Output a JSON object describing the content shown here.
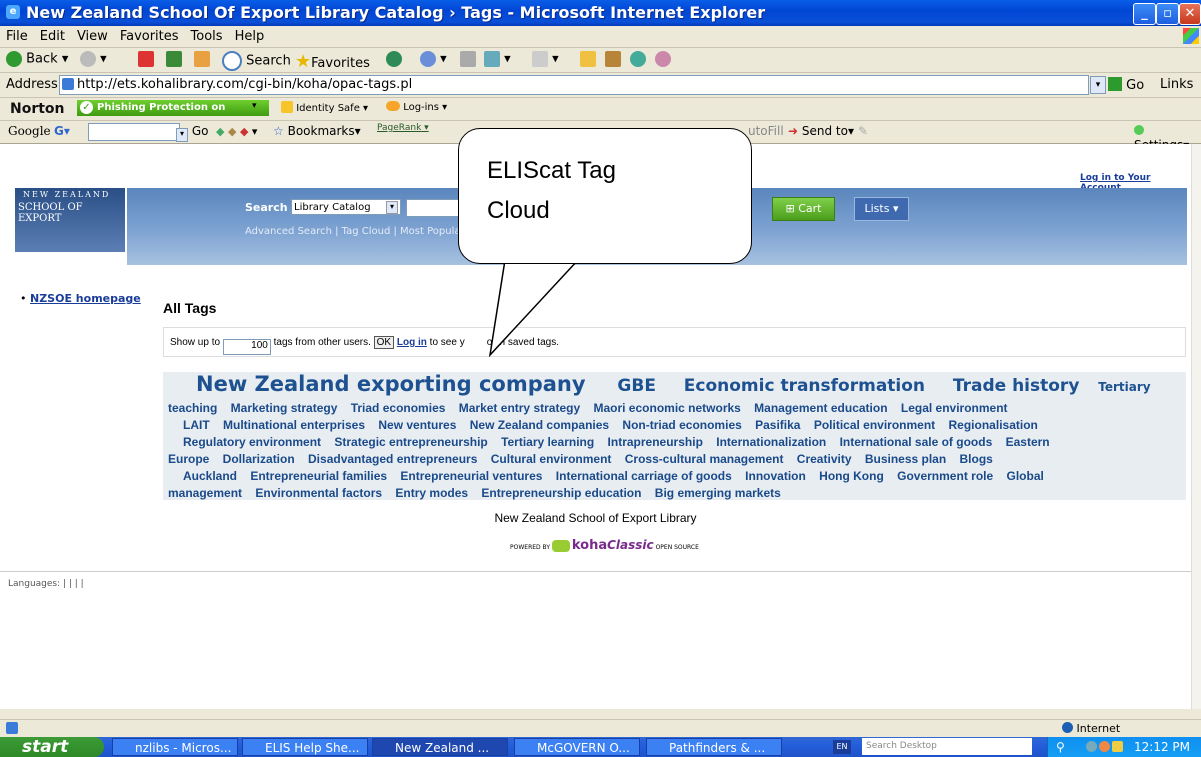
{
  "window": {
    "title": "New Zealand School Of Export Library Catalog › Tags - Microsoft Internet Explorer",
    "minimize": "_",
    "maximize": "▫",
    "close": "✕"
  },
  "menu": [
    "File",
    "Edit",
    "View",
    "Favorites",
    "Tools",
    "Help"
  ],
  "toolbar": {
    "back": "Back",
    "search": "Search",
    "favorites": "Favorites"
  },
  "address": {
    "label": "Address",
    "url": "http://ets.kohalibrary.com/cgi-bin/koha/opac-tags.pl",
    "go": "Go",
    "links": "Links"
  },
  "norton": {
    "brand": "Norton",
    "phishing": "Phishing Protection on",
    "identity": "Identity Safe ▾",
    "logins": "Log-ins ▾"
  },
  "google": {
    "brand": "Google",
    "go": "Go",
    "bookmarks": "Bookmarks▾",
    "pagerank": "PageRank",
    "autofill": "utoFill",
    "sendto": "Send to▾",
    "settings": "Settings▾"
  },
  "page": {
    "login_link": "Log in to Your Account",
    "logo_top": "NEW ZEALAND",
    "logo_bottom": "SCHOOL OF EXPORT",
    "search_label": "Search",
    "search_scope": "Library Catalog",
    "cart": "Cart",
    "lists": "Lists ▾",
    "links_row": "Advanced Search | Tag Cloud | Most Popula",
    "nzsoe_link": "NZSOE homepage",
    "all_tags": "All Tags",
    "show_up_to": "Show up to",
    "show_count": "100",
    "tags_from_users": "tags from other users.",
    "ok": "OK",
    "log_in": "Log in",
    "to_see": "to see y",
    "own_saved": "own saved tags.",
    "footer_library": "New Zealand School of Export Library",
    "powered_by": "POWERED BY",
    "koha": "koha",
    "classic": "Classic",
    "open_source": "OPEN SOURCE",
    "languages": "Languages: | | | |"
  },
  "cloud": {
    "line1_big": "New Zealand exporting company",
    "line1_gbe": "GBE",
    "line1_econ": "Economic transformation",
    "line1_trade": "Trade history",
    "line1_tertiary": "Tertiary",
    "line2": "teaching    Marketing strategy    Triad economies    Market entry strategy    Maori economic networks    Management education    Legal environment",
    "line3": "LAIT    Multinational enterprises    New ventures    New Zealand companies    Non-triad economies    Pasifika    Political environment    Regionalisation",
    "line4": "Regulatory environment    Strategic entrepreneurship    Tertiary learning    Intrapreneurship    Internationalization    International sale of goods    Eastern",
    "line5": "Europe    Dollarization    Disadvantaged entrepreneurs    Cultural environment    Cross-cultural management    Creativity    Business plan    Blogs",
    "line6": "Auckland    Entrepreneurial families    Entrepreneurial ventures    International carriage of goods    Innovation    Hong Kong    Government role    Global",
    "line7": "management    Environmental factors    Entry modes    Entrepreneurship education    Big emerging markets"
  },
  "callout": {
    "line1": "ELIScat Tag",
    "line2": "Cloud"
  },
  "status": {
    "zone": "Internet"
  },
  "taskbar": {
    "start": "start",
    "items": [
      "nzlibs - Micros...",
      "ELIS Help She...",
      "New Zealand ...",
      "McGOVERN O...",
      "Pathfinders & ..."
    ],
    "lang": "EN",
    "search_desktop": "Search Desktop",
    "clock": "12:12 PM"
  }
}
